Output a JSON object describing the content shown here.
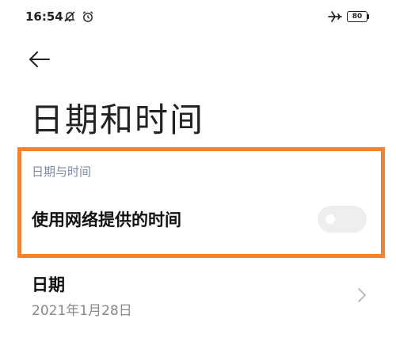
{
  "status_bar": {
    "time": "16:54",
    "battery": "80"
  },
  "header": {
    "title": "日期和时间"
  },
  "section": {
    "header": "日期与时间",
    "network_time": {
      "label": "使用网络提供的时间",
      "enabled": false
    }
  },
  "date_item": {
    "label": "日期",
    "value": "2021年1月28日"
  },
  "colors": {
    "highlight": "#f28330",
    "section_header": "#7a8aa6",
    "toggle_off": "#eeeeee"
  },
  "icons": [
    "mute-icon",
    "alarm-icon",
    "airplane-icon",
    "battery-icon",
    "back-arrow-icon",
    "chevron-right-icon"
  ]
}
